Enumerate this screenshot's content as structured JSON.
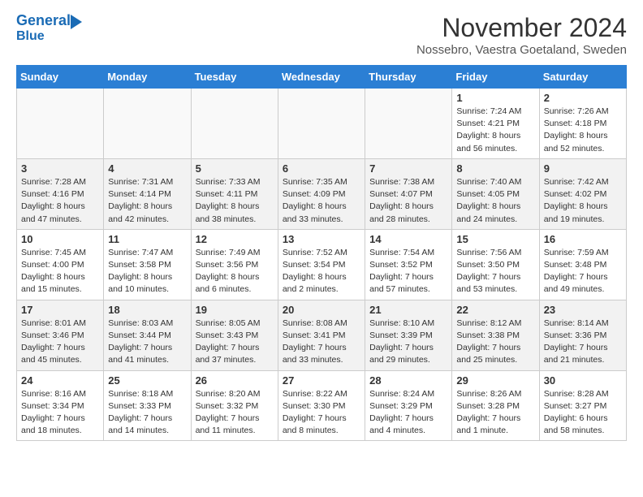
{
  "header": {
    "logo_line1": "General",
    "logo_line2": "Blue",
    "title": "November 2024",
    "subtitle": "Nossebro, Vaestra Goetaland, Sweden"
  },
  "weekdays": [
    "Sunday",
    "Monday",
    "Tuesday",
    "Wednesday",
    "Thursday",
    "Friday",
    "Saturday"
  ],
  "weeks": [
    [
      {
        "day": "",
        "info": ""
      },
      {
        "day": "",
        "info": ""
      },
      {
        "day": "",
        "info": ""
      },
      {
        "day": "",
        "info": ""
      },
      {
        "day": "",
        "info": ""
      },
      {
        "day": "1",
        "info": "Sunrise: 7:24 AM\nSunset: 4:21 PM\nDaylight: 8 hours\nand 56 minutes."
      },
      {
        "day": "2",
        "info": "Sunrise: 7:26 AM\nSunset: 4:18 PM\nDaylight: 8 hours\nand 52 minutes."
      }
    ],
    [
      {
        "day": "3",
        "info": "Sunrise: 7:28 AM\nSunset: 4:16 PM\nDaylight: 8 hours\nand 47 minutes."
      },
      {
        "day": "4",
        "info": "Sunrise: 7:31 AM\nSunset: 4:14 PM\nDaylight: 8 hours\nand 42 minutes."
      },
      {
        "day": "5",
        "info": "Sunrise: 7:33 AM\nSunset: 4:11 PM\nDaylight: 8 hours\nand 38 minutes."
      },
      {
        "day": "6",
        "info": "Sunrise: 7:35 AM\nSunset: 4:09 PM\nDaylight: 8 hours\nand 33 minutes."
      },
      {
        "day": "7",
        "info": "Sunrise: 7:38 AM\nSunset: 4:07 PM\nDaylight: 8 hours\nand 28 minutes."
      },
      {
        "day": "8",
        "info": "Sunrise: 7:40 AM\nSunset: 4:05 PM\nDaylight: 8 hours\nand 24 minutes."
      },
      {
        "day": "9",
        "info": "Sunrise: 7:42 AM\nSunset: 4:02 PM\nDaylight: 8 hours\nand 19 minutes."
      }
    ],
    [
      {
        "day": "10",
        "info": "Sunrise: 7:45 AM\nSunset: 4:00 PM\nDaylight: 8 hours\nand 15 minutes."
      },
      {
        "day": "11",
        "info": "Sunrise: 7:47 AM\nSunset: 3:58 PM\nDaylight: 8 hours\nand 10 minutes."
      },
      {
        "day": "12",
        "info": "Sunrise: 7:49 AM\nSunset: 3:56 PM\nDaylight: 8 hours\nand 6 minutes."
      },
      {
        "day": "13",
        "info": "Sunrise: 7:52 AM\nSunset: 3:54 PM\nDaylight: 8 hours\nand 2 minutes."
      },
      {
        "day": "14",
        "info": "Sunrise: 7:54 AM\nSunset: 3:52 PM\nDaylight: 7 hours\nand 57 minutes."
      },
      {
        "day": "15",
        "info": "Sunrise: 7:56 AM\nSunset: 3:50 PM\nDaylight: 7 hours\nand 53 minutes."
      },
      {
        "day": "16",
        "info": "Sunrise: 7:59 AM\nSunset: 3:48 PM\nDaylight: 7 hours\nand 49 minutes."
      }
    ],
    [
      {
        "day": "17",
        "info": "Sunrise: 8:01 AM\nSunset: 3:46 PM\nDaylight: 7 hours\nand 45 minutes."
      },
      {
        "day": "18",
        "info": "Sunrise: 8:03 AM\nSunset: 3:44 PM\nDaylight: 7 hours\nand 41 minutes."
      },
      {
        "day": "19",
        "info": "Sunrise: 8:05 AM\nSunset: 3:43 PM\nDaylight: 7 hours\nand 37 minutes."
      },
      {
        "day": "20",
        "info": "Sunrise: 8:08 AM\nSunset: 3:41 PM\nDaylight: 7 hours\nand 33 minutes."
      },
      {
        "day": "21",
        "info": "Sunrise: 8:10 AM\nSunset: 3:39 PM\nDaylight: 7 hours\nand 29 minutes."
      },
      {
        "day": "22",
        "info": "Sunrise: 8:12 AM\nSunset: 3:38 PM\nDaylight: 7 hours\nand 25 minutes."
      },
      {
        "day": "23",
        "info": "Sunrise: 8:14 AM\nSunset: 3:36 PM\nDaylight: 7 hours\nand 21 minutes."
      }
    ],
    [
      {
        "day": "24",
        "info": "Sunrise: 8:16 AM\nSunset: 3:34 PM\nDaylight: 7 hours\nand 18 minutes."
      },
      {
        "day": "25",
        "info": "Sunrise: 8:18 AM\nSunset: 3:33 PM\nDaylight: 7 hours\nand 14 minutes."
      },
      {
        "day": "26",
        "info": "Sunrise: 8:20 AM\nSunset: 3:32 PM\nDaylight: 7 hours\nand 11 minutes."
      },
      {
        "day": "27",
        "info": "Sunrise: 8:22 AM\nSunset: 3:30 PM\nDaylight: 7 hours\nand 8 minutes."
      },
      {
        "day": "28",
        "info": "Sunrise: 8:24 AM\nSunset: 3:29 PM\nDaylight: 7 hours\nand 4 minutes."
      },
      {
        "day": "29",
        "info": "Sunrise: 8:26 AM\nSunset: 3:28 PM\nDaylight: 7 hours\nand 1 minute."
      },
      {
        "day": "30",
        "info": "Sunrise: 8:28 AM\nSunset: 3:27 PM\nDaylight: 6 hours\nand 58 minutes."
      }
    ]
  ]
}
